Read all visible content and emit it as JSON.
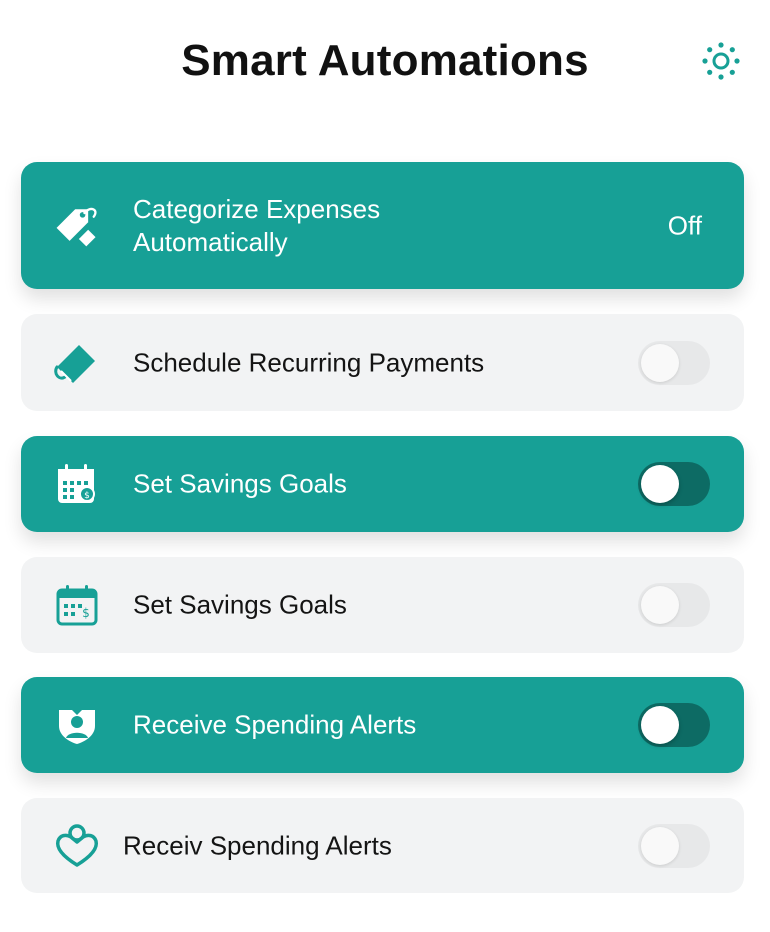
{
  "header": {
    "title": "Smart Automations",
    "settings_icon": "sun-settings-icon"
  },
  "colors": {
    "accent": "#17a096",
    "accent_dark": "#0d6b64",
    "card_inactive": "#f2f3f4",
    "text_dark": "#141414"
  },
  "automations": [
    {
      "label": "Categorize Expenses\nAutomatically",
      "icon": "price-tag-icon",
      "status": "Off",
      "style": "active"
    },
    {
      "label": "Schedule Recurring Payments",
      "icon": "wallet-icon",
      "toggle": "off",
      "style": "inactive"
    },
    {
      "label": "Set Savings Goals",
      "icon": "calendar-icon",
      "toggle": "off",
      "style": "active"
    },
    {
      "label": "Set Savings Goals",
      "icon": "calendar-icon",
      "toggle": "off",
      "style": "inactive"
    },
    {
      "label": "Receive Spending Alerts",
      "icon": "shield-user-icon",
      "toggle": "off",
      "style": "active"
    },
    {
      "label": "Receiv Spending Alerts",
      "icon": "heart-user-icon",
      "toggle": "off",
      "style": "inactive"
    }
  ]
}
